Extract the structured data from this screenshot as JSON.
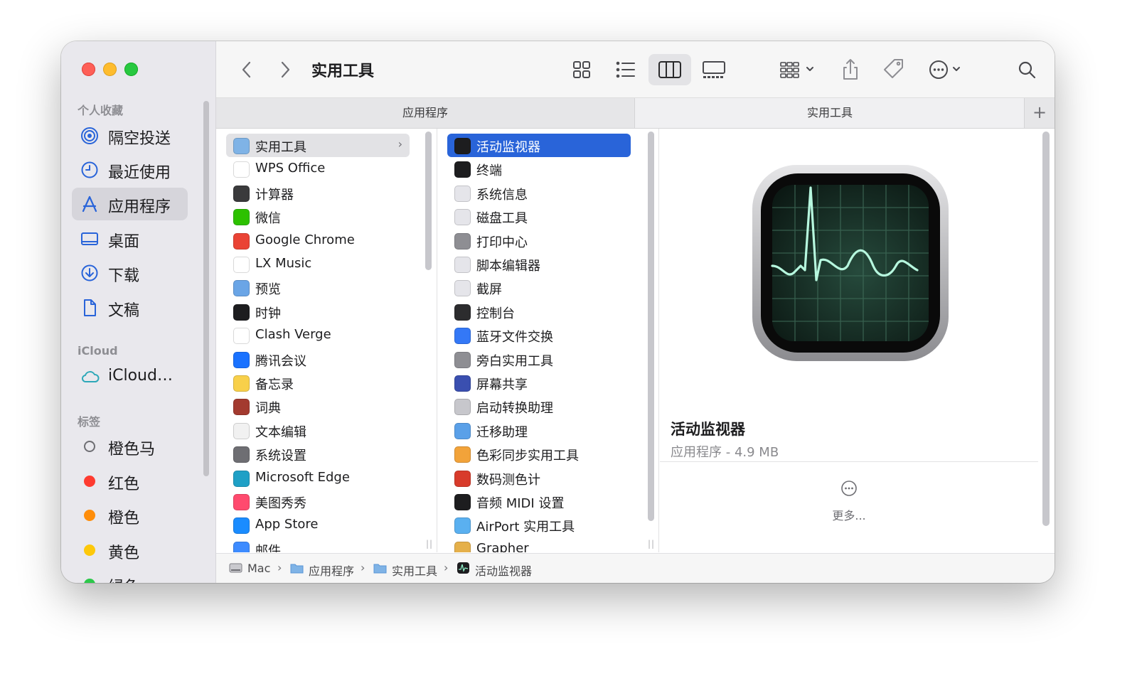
{
  "window": {
    "title": "实用工具"
  },
  "sidebar": {
    "favorites_header": "个人收藏",
    "favorites": [
      {
        "label": "隔空投送",
        "icon": "airdrop-icon"
      },
      {
        "label": "最近使用",
        "icon": "clock-icon"
      },
      {
        "label": "应用程序",
        "icon": "applications-icon",
        "selected": true
      },
      {
        "label": "桌面",
        "icon": "desktop-icon"
      },
      {
        "label": "下载",
        "icon": "download-icon"
      },
      {
        "label": "文稿",
        "icon": "document-icon"
      }
    ],
    "icloud_header": "iCloud",
    "icloud": [
      {
        "label": "iCloud…",
        "icon": "cloud-icon"
      }
    ],
    "tags_header": "标签",
    "tags": [
      {
        "label": "橙色马",
        "color": ""
      },
      {
        "label": "红色",
        "color": "#fe3b30"
      },
      {
        "label": "橙色",
        "color": "#fe8d0a"
      },
      {
        "label": "黄色",
        "color": "#fdc80a"
      },
      {
        "label": "绿色",
        "color": "#2cc84a"
      }
    ]
  },
  "toolbar": {
    "icons": [
      "back-icon",
      "forward-icon",
      "icon-view-icon",
      "list-view-icon",
      "column-view-icon",
      "gallery-view-icon",
      "group-icon",
      "share-icon",
      "tag-icon",
      "more-actions-icon",
      "search-icon"
    ],
    "active_view": "column"
  },
  "tabs": [
    {
      "label": "应用程序"
    },
    {
      "label": "实用工具",
      "active": true
    }
  ],
  "columns": {
    "applications": [
      {
        "label": "实用工具",
        "icon": "folder-icon",
        "color": "#7fb3e6",
        "selected": true,
        "has_children": true
      },
      {
        "label": "WPS Office",
        "icon": "wps-icon",
        "color": "#ffffff"
      },
      {
        "label": "计算器",
        "icon": "calculator-icon",
        "color": "#3a3a3c"
      },
      {
        "label": "微信",
        "icon": "wechat-icon",
        "color": "#2dc100"
      },
      {
        "label": "Google Chrome",
        "icon": "chrome-icon",
        "color": "#ea4335"
      },
      {
        "label": "LX Music",
        "icon": "music-icon",
        "color": "#ffffff"
      },
      {
        "label": "预览",
        "icon": "preview-icon",
        "color": "#6aa5e6"
      },
      {
        "label": "时钟",
        "icon": "clock-app-icon",
        "color": "#1d1d1f"
      },
      {
        "label": "Clash Verge",
        "icon": "clash-icon",
        "color": "#ffffff"
      },
      {
        "label": "腾讯会议",
        "icon": "tencent-meeting-icon",
        "color": "#1a72ff"
      },
      {
        "label": "备忘录",
        "icon": "notes-icon",
        "color": "#f8d04a"
      },
      {
        "label": "词典",
        "icon": "dictionary-icon",
        "color": "#a33a2f"
      },
      {
        "label": "文本编辑",
        "icon": "textedit-icon",
        "color": "#f1f1f1"
      },
      {
        "label": "系统设置",
        "icon": "settings-icon",
        "color": "#6e6e73"
      },
      {
        "label": "Microsoft Edge",
        "icon": "edge-icon",
        "color": "#1fa0c6"
      },
      {
        "label": "美图秀秀",
        "icon": "meitu-icon",
        "color": "#ff4a6e"
      },
      {
        "label": "App Store",
        "icon": "appstore-icon",
        "color": "#1a8cff"
      },
      {
        "label": "邮件",
        "icon": "mail-icon",
        "color": "#3d8bff"
      }
    ],
    "utilities": [
      {
        "label": "活动监视器",
        "icon": "activity-monitor-icon",
        "color": "#1d1d1f",
        "selected": true
      },
      {
        "label": "终端",
        "icon": "terminal-icon",
        "color": "#1d1d1f"
      },
      {
        "label": "系统信息",
        "icon": "system-info-icon",
        "color": "#e5e5ea"
      },
      {
        "label": "磁盘工具",
        "icon": "disk-utility-icon",
        "color": "#e5e5ea"
      },
      {
        "label": "打印中心",
        "icon": "print-center-icon",
        "color": "#8e8e93"
      },
      {
        "label": "脚本编辑器",
        "icon": "script-editor-icon",
        "color": "#e5e5ea"
      },
      {
        "label": "截屏",
        "icon": "screenshot-icon",
        "color": "#e5e5ea"
      },
      {
        "label": "控制台",
        "icon": "console-icon",
        "color": "#2c2c2e"
      },
      {
        "label": "蓝牙文件交换",
        "icon": "bluetooth-icon",
        "color": "#3478f6"
      },
      {
        "label": "旁白实用工具",
        "icon": "voiceover-icon",
        "color": "#8e8e93"
      },
      {
        "label": "屏幕共享",
        "icon": "screen-sharing-icon",
        "color": "#3a4fb0"
      },
      {
        "label": "启动转换助理",
        "icon": "bootcamp-icon",
        "color": "#c7c7cc"
      },
      {
        "label": "迁移助理",
        "icon": "migration-icon",
        "color": "#5aa0e8"
      },
      {
        "label": "色彩同步实用工具",
        "icon": "colorsync-icon",
        "color": "#f2a33a"
      },
      {
        "label": "数码测色计",
        "icon": "colormeter-icon",
        "color": "#d83b2b"
      },
      {
        "label": "音频 MIDI 设置",
        "icon": "midi-icon",
        "color": "#1d1d1f"
      },
      {
        "label": "AirPort 实用工具",
        "icon": "airport-icon",
        "color": "#5ab0f0"
      },
      {
        "label": "Grapher",
        "icon": "grapher-icon",
        "color": "#e5b04a"
      }
    ]
  },
  "preview": {
    "icon": "activity-monitor-large-icon",
    "name": "活动监视器",
    "meta": "应用程序 - 4.9 MB",
    "more_label": "更多..."
  },
  "pathbar": [
    {
      "label": "Mac",
      "icon": "hard-drive-icon"
    },
    {
      "label": "应用程序",
      "icon": "folder-icon"
    },
    {
      "label": "实用工具",
      "icon": "folder-icon"
    },
    {
      "label": "活动监视器",
      "icon": "activity-monitor-icon"
    }
  ]
}
